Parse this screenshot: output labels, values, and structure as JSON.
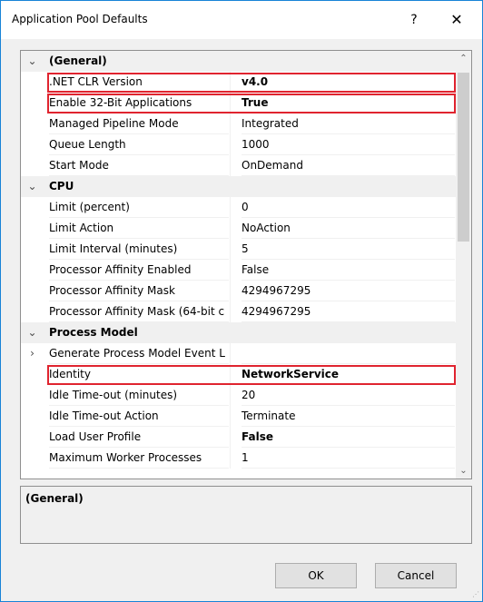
{
  "window": {
    "title": "Application Pool Defaults",
    "help_glyph": "?",
    "close_glyph": "✕"
  },
  "grid": {
    "rows": [
      {
        "type": "category",
        "gutter": "⌄",
        "name": "(General)",
        "highlight": false
      },
      {
        "type": "property",
        "gutter": "",
        "name": ".NET CLR Version",
        "value": "v4.0",
        "bold": true,
        "highlight": true
      },
      {
        "type": "property",
        "gutter": "",
        "name": "Enable 32-Bit Applications",
        "value": "True",
        "bold": true,
        "highlight": true
      },
      {
        "type": "property",
        "gutter": "",
        "name": "Managed Pipeline Mode",
        "value": "Integrated",
        "bold": false,
        "highlight": false
      },
      {
        "type": "property",
        "gutter": "",
        "name": "Queue Length",
        "value": "1000",
        "bold": false,
        "highlight": false
      },
      {
        "type": "property",
        "gutter": "",
        "name": "Start Mode",
        "value": "OnDemand",
        "bold": false,
        "highlight": false
      },
      {
        "type": "category",
        "gutter": "⌄",
        "name": "CPU",
        "highlight": false
      },
      {
        "type": "property",
        "gutter": "",
        "name": "Limit (percent)",
        "value": "0",
        "bold": false,
        "highlight": false
      },
      {
        "type": "property",
        "gutter": "",
        "name": "Limit Action",
        "value": "NoAction",
        "bold": false,
        "highlight": false
      },
      {
        "type": "property",
        "gutter": "",
        "name": "Limit Interval (minutes)",
        "value": "5",
        "bold": false,
        "highlight": false
      },
      {
        "type": "property",
        "gutter": "",
        "name": "Processor Affinity Enabled",
        "value": "False",
        "bold": false,
        "highlight": false
      },
      {
        "type": "property",
        "gutter": "",
        "name": "Processor Affinity Mask",
        "value": "4294967295",
        "bold": false,
        "highlight": false
      },
      {
        "type": "property",
        "gutter": "",
        "name": "Processor Affinity Mask (64-bit c",
        "value": "4294967295",
        "bold": false,
        "highlight": false
      },
      {
        "type": "category",
        "gutter": "⌄",
        "name": "Process Model",
        "highlight": false
      },
      {
        "type": "property",
        "gutter": "›",
        "name": "Generate Process Model Event L",
        "value": "",
        "bold": false,
        "highlight": false
      },
      {
        "type": "property",
        "gutter": "",
        "name": "Identity",
        "value": "NetworkService",
        "bold": true,
        "highlight": true
      },
      {
        "type": "property",
        "gutter": "",
        "name": "Idle Time-out (minutes)",
        "value": "20",
        "bold": false,
        "highlight": false
      },
      {
        "type": "property",
        "gutter": "",
        "name": "Idle Time-out Action",
        "value": "Terminate",
        "bold": false,
        "highlight": false
      },
      {
        "type": "property",
        "gutter": "",
        "name": "Load User Profile",
        "value": "False",
        "bold": true,
        "highlight": false
      },
      {
        "type": "property",
        "gutter": "",
        "name": "Maximum Worker Processes",
        "value": "1",
        "bold": false,
        "highlight": false
      }
    ]
  },
  "scrollbar": {
    "up_glyph": "⌃",
    "down_glyph": "⌄"
  },
  "description": {
    "title": "(General)"
  },
  "buttons": {
    "ok": "OK",
    "cancel": "Cancel"
  },
  "colors": {
    "highlight_border": "#e0242f",
    "window_border": "#1883d7"
  }
}
